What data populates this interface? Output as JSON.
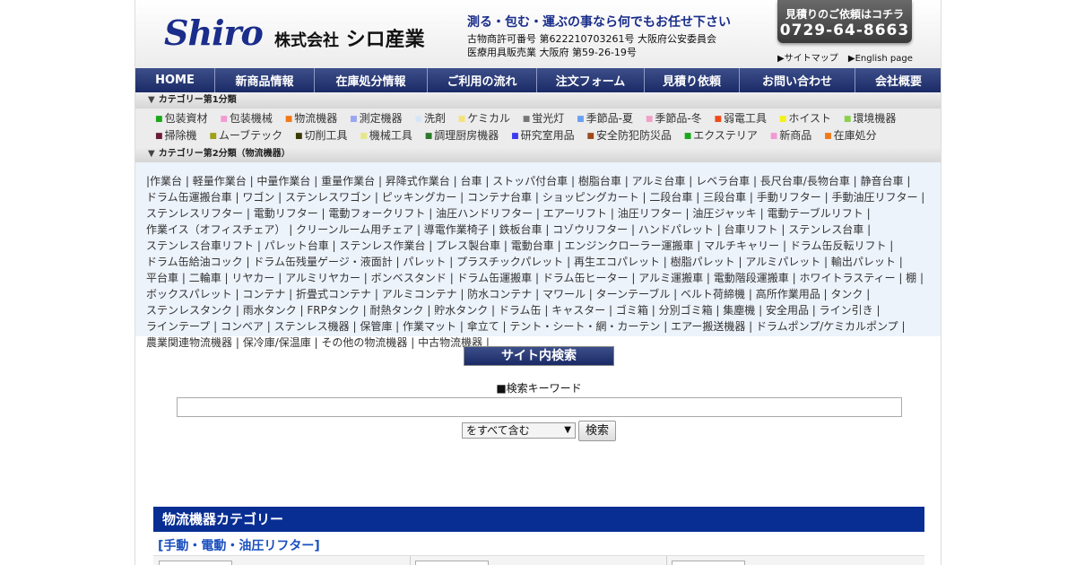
{
  "header": {
    "logo_text": "Shiro",
    "company_prefix": "株式会社",
    "company_name": "シロ産業",
    "slogan": "測る・包む・運ぶの事なら何でもお任せ下さい",
    "license1": "古物商許可番号 第622210703261号 大阪府公安委員会",
    "license2": "医療用具販売業 大阪府 第59-26-19号",
    "quote_label": "見積りのご依頼はコチラ",
    "quote_phone": "0729-64-8663",
    "links": [
      "▶サイトマップ",
      "▶English page"
    ]
  },
  "nav": [
    {
      "label": "HOME",
      "w": 89
    },
    {
      "label": "新商品情報",
      "w": 111
    },
    {
      "label": "在庫処分情報",
      "w": 126
    },
    {
      "label": "ご利用の流れ",
      "w": 122
    },
    {
      "label": "注文フォーム",
      "w": 120
    },
    {
      "label": "見積り依頼",
      "w": 106
    },
    {
      "label": "お問い合わせ",
      "w": 129
    },
    {
      "label": "会社概要",
      "w": 97
    }
  ],
  "category1": {
    "heading": "カテゴリー第1分類",
    "items": [
      {
        "label": "包装資材",
        "color": "#1aa81a"
      },
      {
        "label": "包装機械",
        "color": "#f29ad3"
      },
      {
        "label": "物流機器",
        "color": "#f07a1a"
      },
      {
        "label": "測定機器",
        "color": "#9aa6f0"
      },
      {
        "label": "洗剤",
        "color": "#d7e6f7"
      },
      {
        "label": "ケミカル",
        "color": "#f5e27a"
      },
      {
        "label": "蛍光灯",
        "color": "#777777"
      },
      {
        "label": "季節品-夏",
        "color": "#6aa0f0"
      },
      {
        "label": "季節品-冬",
        "color": "#f2a0c8"
      },
      {
        "label": "弱電工具",
        "color": "#f04a1a"
      },
      {
        "label": "ホイスト",
        "color": "#f5f01a"
      },
      {
        "label": "環境機器",
        "color": "#8ad04a"
      },
      {
        "label": "掃除機",
        "color": "#6a1a3a"
      },
      {
        "label": "ムーブテック",
        "color": "#a0a01a"
      },
      {
        "label": "切削工具",
        "color": "#3a3a00"
      },
      {
        "label": "機械工具",
        "color": "#e6e68a"
      },
      {
        "label": "調理厨房機器",
        "color": "#2a7a2a"
      },
      {
        "label": "研究室用品",
        "color": "#3a3af0"
      },
      {
        "label": "安全防犯防災品",
        "color": "#a04a1a"
      },
      {
        "label": "エクステリア",
        "color": "#1aa81a"
      },
      {
        "label": "新商品",
        "color": "#f29ad3"
      },
      {
        "label": "在庫処分",
        "color": "#f07a1a"
      }
    ]
  },
  "category2": {
    "heading": "カテゴリー第2分類（物流機器）",
    "items": [
      "作業台",
      "軽量作業台",
      "中量作業台",
      "重量作業台",
      "昇降式作業台",
      "台車",
      "ストッパ付台車",
      "樹脂台車",
      "アルミ台車",
      "レベラ台車",
      "長尺台車/長物台車",
      "静音台車",
      "ドラム缶運搬台車",
      "ワゴン",
      "ステンレスワゴン",
      "ピッキングカー",
      "コンテナ台車",
      "ショッピングカート",
      "二段台車",
      "三段台車",
      "手動リフター",
      "手動油圧リフター",
      "ステンレスリフター",
      "電動リフター",
      "電動フォークリフト",
      "油圧ハンドリフター",
      "エアーリフト",
      "油圧リフター",
      "油圧ジャッキ",
      "電動テーブルリフト",
      "作業イス（オフィスチェア）",
      "クリーンルーム用チェア",
      "導電作業椅子",
      "鉄板台車",
      "コゾウリフター",
      "ハンドパレット",
      "台車リフト",
      "ステンレス台車",
      "ステンレス台車リフト",
      "パレット台車",
      "ステンレス作業台",
      "プレス製台車",
      "電動台車",
      "エンジンクローラー運搬車",
      "マルチキャリー",
      "ドラム缶反転リフト",
      "ドラム缶給油コック",
      "ドラム缶残量ゲージ・液面計",
      "パレット",
      "プラスチックパレット",
      "再生エコパレット",
      "樹脂パレット",
      "アルミパレット",
      "輸出パレット",
      "平台車",
      "二輪車",
      "リヤカー",
      "アルミリヤカー",
      "ボンベスタンド",
      "ドラム缶運搬車",
      "ドラム缶ヒーター",
      "アルミ運搬車",
      "電動階段運搬車",
      "ホワイトラスティー",
      "棚",
      "ボックスパレット",
      "コンテナ",
      "折畳式コンテナ",
      "アルミコンテナ",
      "防水コンテナ",
      "マワール",
      "ターンテーブル",
      "ベルト荷締機",
      "高所作業用品",
      "タンク",
      "ステンレスタンク",
      "雨水タンク",
      "FRPタンク",
      "耐熱タンク",
      "貯水タンク",
      "ドラム缶",
      "キャスター",
      "ゴミ箱",
      "分別ゴミ箱",
      "集塵機",
      "安全用品",
      "ライン引き",
      "ラインテープ",
      "コンベア",
      "ステンレス機器",
      "保管庫",
      "作業マット",
      "傘立て",
      "テント・シート・網・カーテン",
      "エアー搬送機器",
      "ドラムポンプ/ケミカルポンプ",
      "農業関連物流機器",
      "保冷庫/保温庫",
      "その他の物流機器",
      "中古物流機器"
    ]
  },
  "search": {
    "title": "サイト内検索",
    "keyword_label": "■検索キーワード",
    "select_value": "をすべて含む",
    "button_label": "検索"
  },
  "category_bar": "物流機器カテゴリー",
  "sub_heading": "[手動・電動・油圧リフター]"
}
